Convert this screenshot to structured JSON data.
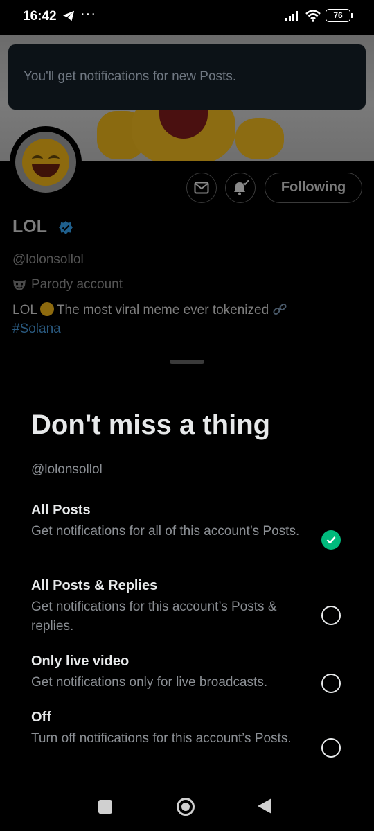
{
  "status_bar": {
    "time": "16:42",
    "overflow": "···",
    "battery": "76",
    "icons": [
      "telegram-icon",
      "signal-icon",
      "wifi-icon",
      "battery-icon"
    ]
  },
  "toast": {
    "message": "You'll get notifications for new Posts."
  },
  "profile": {
    "name": "LOL",
    "handle": "@lolonsollol",
    "label": "Parody account",
    "bio": "LOL",
    "bio_rest": "The most viral meme ever tokenized",
    "hashtag": "#Solana",
    "follow_button": "Following",
    "icons": [
      "message-icon",
      "notification-bell-icon",
      "verified-badge-icon",
      "parody-mask-icon",
      "link-icon"
    ]
  },
  "sheet": {
    "title": "Don't miss a thing",
    "handle": "@lolonsollol",
    "options": [
      {
        "title": "All Posts",
        "description": "Get notifications for all of this account’s Posts.",
        "selected": true
      },
      {
        "title": "All Posts & Replies",
        "description": "Get notifications for this account’s Posts & replies.",
        "selected": false
      },
      {
        "title": "Only live video",
        "description": "Get notifications only for live broadcasts.",
        "selected": false
      },
      {
        "title": "Off",
        "description": "Turn off notifications for this account’s Posts.",
        "selected": false
      }
    ]
  },
  "nav_bar": {
    "icons": [
      "recents-square-icon",
      "home-circle-icon",
      "back-triangle-icon"
    ]
  },
  "colors": {
    "accent_green": "#00ba7c",
    "verified_blue": "#1d9bf0",
    "background": "#000000"
  }
}
